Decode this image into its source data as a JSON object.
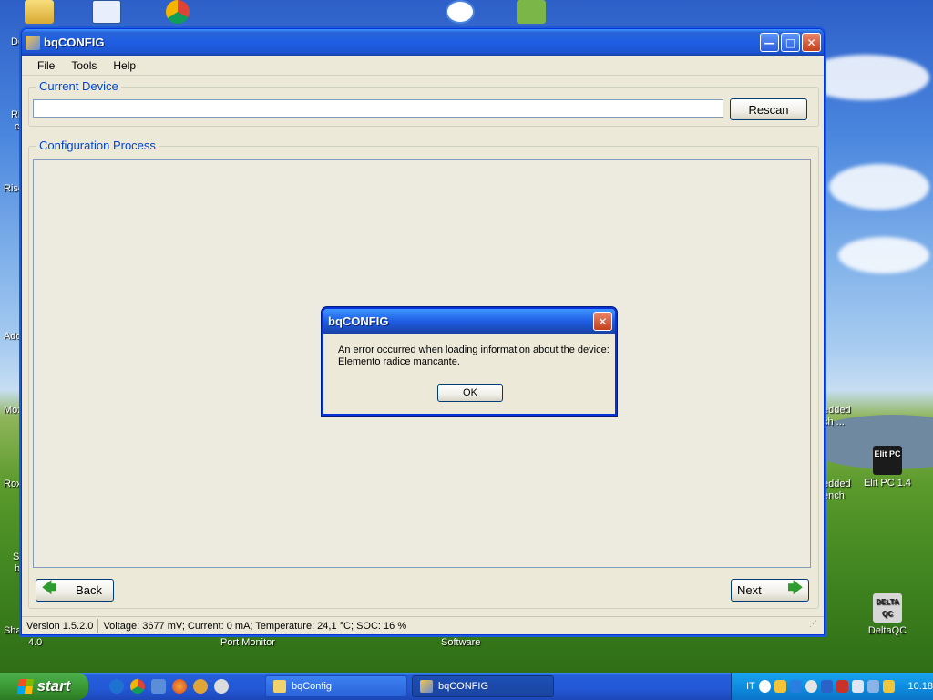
{
  "desktop": {
    "icons": [
      {
        "label": "Elit PC 1.4",
        "badge": "Elit PC"
      },
      {
        "label": "DeltaQC",
        "badge": "DELTA QC"
      },
      {
        "label": "Port Monitor"
      },
      {
        "label": "Software"
      },
      {
        "label": "4.0"
      }
    ],
    "edge_labels": [
      "De",
      "Ri",
      "c",
      "Risc",
      "Add",
      "Moz",
      "Rox",
      "S",
      "b",
      "Sha",
      "edded",
      "ch ...",
      "edded",
      "ench"
    ]
  },
  "window": {
    "title": "bqCONFIG",
    "menu": [
      "File",
      "Tools",
      "Help"
    ],
    "current_device": {
      "label": "Current Device",
      "value": "",
      "rescan_label": "Rescan"
    },
    "configuration": {
      "label": "Configuration Process"
    },
    "nav": {
      "back_label": "Back",
      "next_label": "Next"
    },
    "status": {
      "version": "Version 1.5.2.0",
      "readings": "Voltage: 3677 mV; Current: 0 mA; Temperature: 24,1 °C; SOC: 16 %"
    }
  },
  "dialog": {
    "title": "bqCONFIG",
    "message_line1": "An error occurred when loading information about the device:",
    "message_line2": "Elemento radice mancante.",
    "ok_label": "OK"
  },
  "taskbar": {
    "start_label": "start",
    "tasks": [
      {
        "label": "bqConfig",
        "icon": "folder-icon"
      },
      {
        "label": "bqCONFIG",
        "icon": "app-icon",
        "active": true
      }
    ],
    "tray": {
      "language": "IT",
      "clock": "10.18"
    }
  },
  "colors": {
    "xp_blue": "#245edb",
    "title_text": "#ffffff",
    "group_label": "#0046d5",
    "start_green": "#3c9a36"
  }
}
